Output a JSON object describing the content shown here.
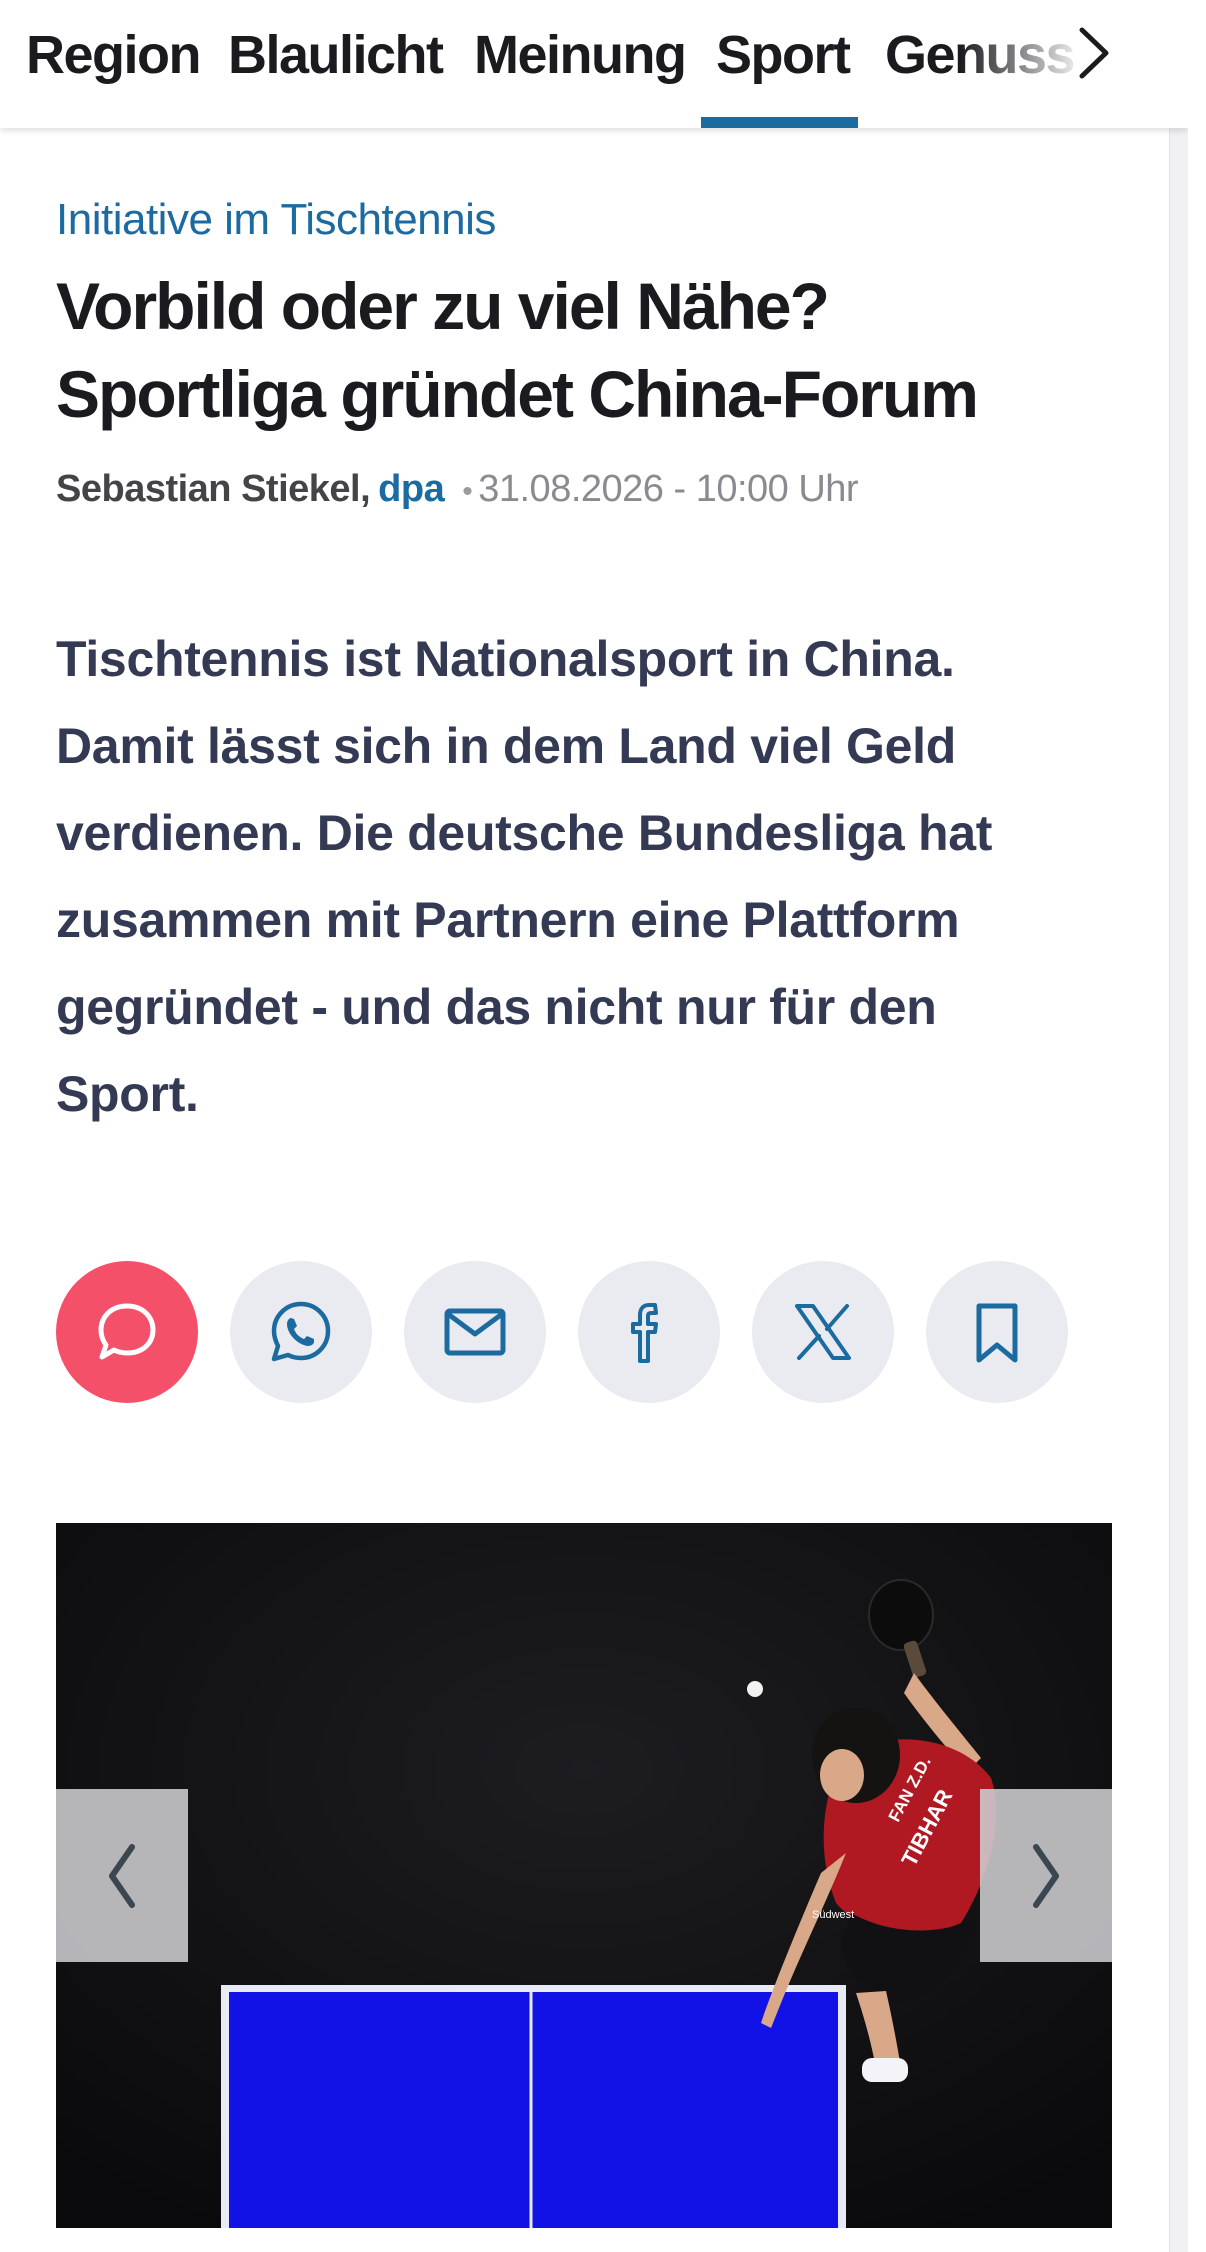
{
  "nav": {
    "items": [
      "Region",
      "Blaulicht",
      "Meinung",
      "Sport",
      "Genuss"
    ],
    "active": "Sport",
    "active_color": "#1b6aa0"
  },
  "article": {
    "kicker": "Initiative im Tischtennis",
    "headline": "Vorbild oder zu viel Nähe? Sportliga gründet China-Forum",
    "author": "Sebastian Stiekel,",
    "agency": "dpa",
    "separator": "•",
    "datetime": "31.08.2026 - 10:00 Uhr",
    "teaser": "Tischtennis ist Nationalsport in China. Damit lässt sich in dem Land viel Geld verdienen. Die deutsche Bundesliga hat zusammen mit Partnern eine Plattform gegründet - und das nicht nur für den Sport."
  },
  "share": {
    "buttons": [
      "comment-icon",
      "whatsapp-icon",
      "mail-icon",
      "facebook-icon",
      "x-icon",
      "bookmark-icon"
    ],
    "primary_color": "#f4506a"
  },
  "gallery": {
    "jersey_text": [
      "FAN Z.D.",
      "TIBHAR",
      "Südwest"
    ],
    "table_color": "#1212e6"
  }
}
